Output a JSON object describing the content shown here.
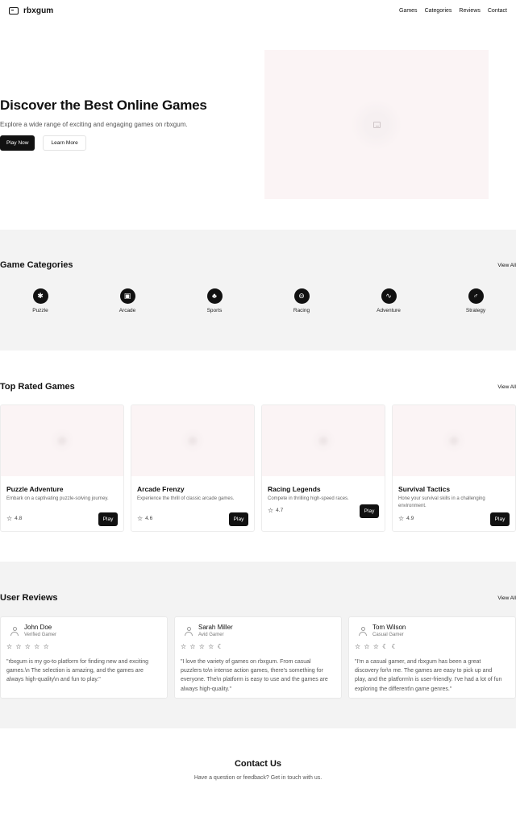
{
  "header": {
    "brand": "rbxgum",
    "nav": [
      "Games",
      "Categories",
      "Reviews",
      "Contact"
    ]
  },
  "hero": {
    "title": "Discover the Best Online Games",
    "subtitle": "Explore a wide range of exciting and engaging games on rbxgum.",
    "primary_button": "Play Now",
    "secondary_button": "Learn More",
    "image_icon": "image-placeholder-icon"
  },
  "categories": {
    "title": "Game Categories",
    "view_all": "View All",
    "items": [
      {
        "label": "Puzzle",
        "icon": "puzzle-icon",
        "glyph": "✱"
      },
      {
        "label": "Arcade",
        "icon": "arcade-icon",
        "glyph": "▣"
      },
      {
        "label": "Sports",
        "icon": "sports-icon",
        "glyph": "♣"
      },
      {
        "label": "Racing",
        "icon": "racing-icon",
        "glyph": "⊖"
      },
      {
        "label": "Adventure",
        "icon": "adventure-icon",
        "glyph": "∿"
      },
      {
        "label": "Strategy",
        "icon": "strategy-icon",
        "glyph": "♂"
      }
    ]
  },
  "top_rated": {
    "title": "Top Rated Games",
    "view_all": "View All",
    "games": [
      {
        "title": "Puzzle Adventure",
        "desc": "Embark on a captivating puzzle-solving journey.",
        "rating": "4.8",
        "play": "Play"
      },
      {
        "title": "Arcade Frenzy",
        "desc": "Experience the thrill of classic arcade games.",
        "rating": "4.6",
        "play": "Play"
      },
      {
        "title": "Racing Legends",
        "desc": "Compete in thrilling high-speed races.",
        "rating": "4.7",
        "play": "Play"
      },
      {
        "title": "Survival Tactics",
        "desc": "Hone your survival skills in a challenging environment.",
        "rating": "4.9",
        "play": "Play"
      }
    ]
  },
  "reviews": {
    "title": "User Reviews",
    "view_all": "View All",
    "items": [
      {
        "name": "John Doe",
        "role": "Verified Gamer",
        "stars": "☆ ☆ ☆ ☆ ☆",
        "text": "\"rbxgum is my go-to platform for finding new and exciting games.\\n The selection is amazing, and the games are always high-quality\\n and fun to play.\""
      },
      {
        "name": "Sarah Miller",
        "role": "Avid Gamer",
        "stars": "☆ ☆ ☆ ☆ ☾",
        "text": "\"I love the variety of games on rbxgum. From casual puzzlers to\\n intense action games, there's something for everyone. The\\n platform is easy to use and the games are always high-quality.\""
      },
      {
        "name": "Tom Wilson",
        "role": "Casual Gamer",
        "stars": "☆ ☆ ☆ ☾ ☾",
        "text": "\"I'm a casual gamer, and rbxgum has been a great discovery for\\n me. The games are easy to pick up and play, and the platform\\n is user-friendly. I've had a lot of fun exploring the different\\n game genres.\""
      }
    ]
  },
  "contact": {
    "title": "Contact Us",
    "subtitle": "Have a question or feedback? Get in touch with us."
  }
}
